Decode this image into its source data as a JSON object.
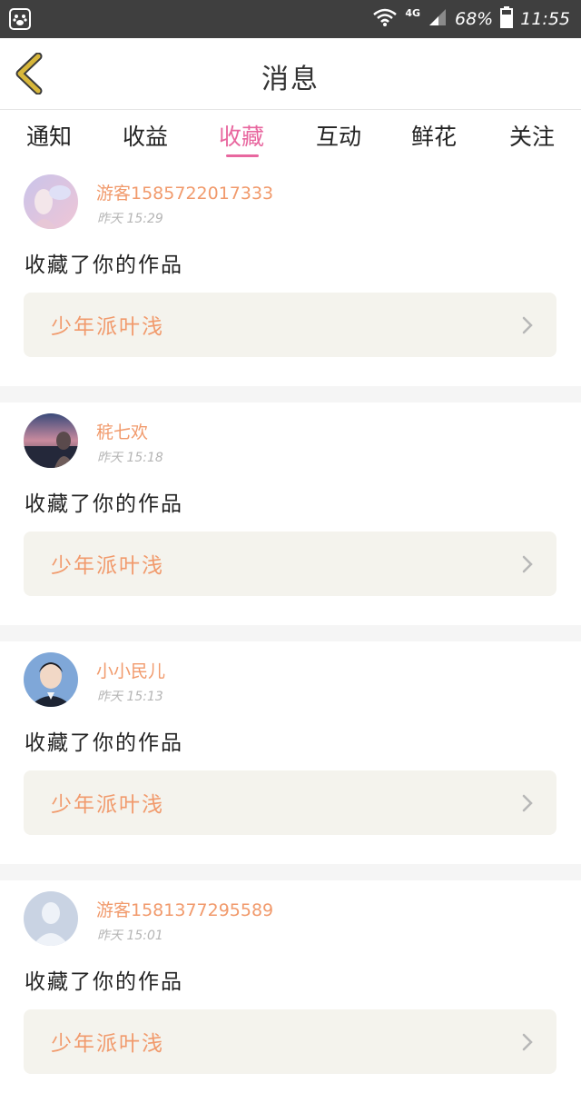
{
  "status_bar": {
    "network": "4G",
    "battery": "68%",
    "time": "11:55"
  },
  "header": {
    "title": "消息"
  },
  "tabs": [
    {
      "label": "通知"
    },
    {
      "label": "收益"
    },
    {
      "label": "收藏"
    },
    {
      "label": "互动"
    },
    {
      "label": "鲜花"
    },
    {
      "label": "关注"
    }
  ],
  "active_tab": "收藏",
  "notifications": [
    {
      "username": "游客1585722017333",
      "time": "昨天 15:29",
      "action": "收藏了你的作品",
      "work_title": "少年派叶浅"
    },
    {
      "username": "䅊七欢",
      "time": "昨天 15:18",
      "action": "收藏了你的作品",
      "work_title": "少年派叶浅"
    },
    {
      "username": "小小民儿",
      "time": "昨天 15:13",
      "action": "收藏了你的作品",
      "work_title": "少年派叶浅"
    },
    {
      "username": "游客1581377295589",
      "time": "昨天 15:01",
      "action": "收藏了你的作品",
      "work_title": "少年派叶浅"
    }
  ],
  "colors": {
    "accent": "#e8679f",
    "username": "#f19a6c",
    "back_icon": "#d8b73a",
    "card_link_bg": "#f4f3ed"
  }
}
